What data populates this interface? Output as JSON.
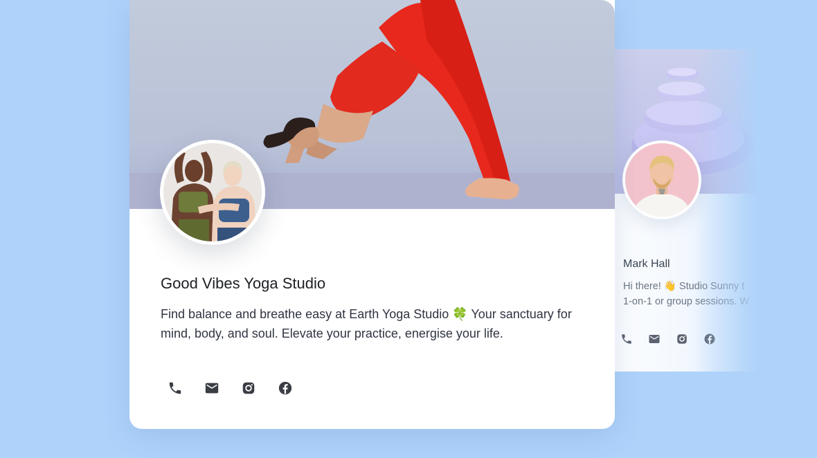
{
  "main_card": {
    "title": "Good Vibes Yoga Studio",
    "description": "Find balance and breathe easy at Earth Yoga Studio 🍀 Your sanctuary for mind, body, and soul. Elevate your practice, energise your life.",
    "contacts": [
      {
        "icon": "phone-icon"
      },
      {
        "icon": "mail-icon"
      },
      {
        "icon": "instagram-icon"
      },
      {
        "icon": "facebook-icon"
      }
    ]
  },
  "secondary_card": {
    "name": "Mark Hall",
    "bio_line1": "Hi there! 👋 Studio Sunny t",
    "bio_line2": "1-on-1 or group sessions. W",
    "contacts": [
      {
        "icon": "phone-icon"
      },
      {
        "icon": "mail-icon"
      },
      {
        "icon": "instagram-icon"
      },
      {
        "icon": "facebook-icon"
      }
    ]
  },
  "colors": {
    "background": "#aed2fa",
    "card": "#ffffff",
    "title_text": "#1d1f24",
    "icon": "#3a3d44"
  }
}
